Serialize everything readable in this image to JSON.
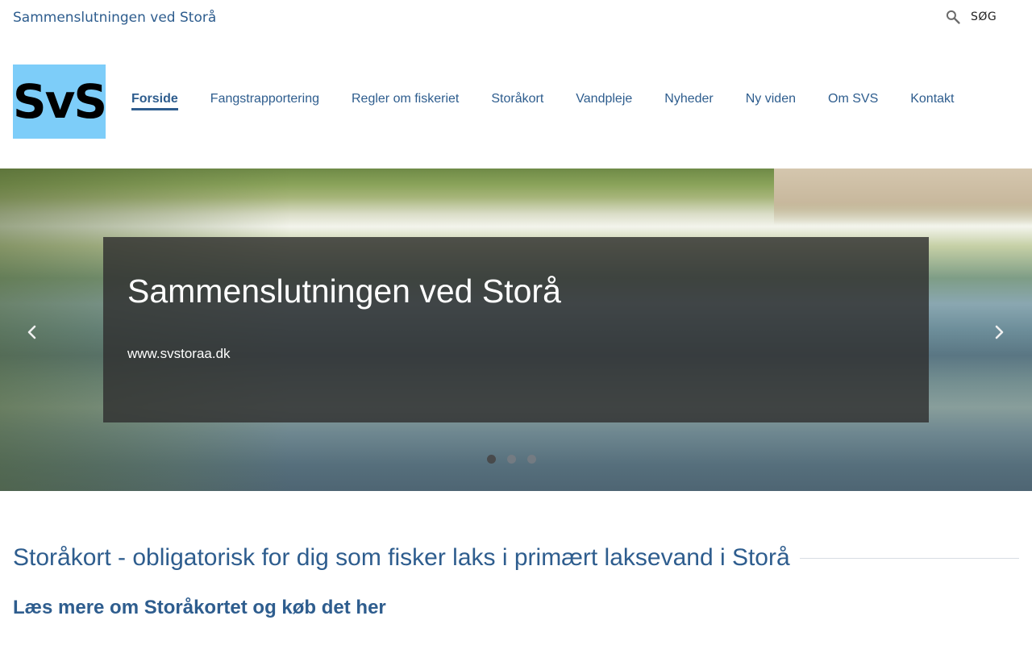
{
  "site": {
    "title": "Sammenslutningen ved Storå"
  },
  "search": {
    "label": "SØG",
    "icon": "search-icon"
  },
  "logo": {
    "text": "SvS",
    "bg_color": "#7dcdf9"
  },
  "nav": {
    "items": [
      {
        "label": "Forside",
        "active": true
      },
      {
        "label": "Fangstrapportering"
      },
      {
        "label": "Regler om fiskeriet"
      },
      {
        "label": "Storåkort"
      },
      {
        "label": "Vandpleje"
      },
      {
        "label": "Nyheder"
      },
      {
        "label": "Ny viden"
      },
      {
        "label": "Om SVS"
      },
      {
        "label": "Kontakt"
      }
    ]
  },
  "hero": {
    "title": "Sammenslutningen ved Storå",
    "subtitle": "www.svstoraa.dk",
    "prev_icon": "chevron-left-icon",
    "next_icon": "chevron-right-icon",
    "slide_count": 3,
    "active_slide": 1
  },
  "content": {
    "heading": "Storåkort - obligatorisk for dig som fisker laks i primært laksevand i Storå",
    "read_more_text": "Læs mere om Storåkortet og køb det ",
    "read_more_link": "her"
  },
  "colors": {
    "accent": "#2e5d8e",
    "overlay": "#303030"
  }
}
